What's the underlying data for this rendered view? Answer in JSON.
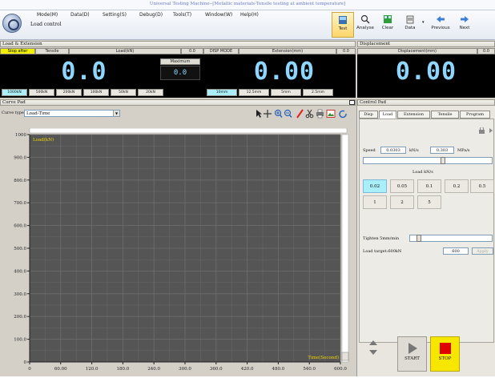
{
  "window": {
    "title": "Universal Testing Machine--[Metallic materials-Tensile testing at ambient temperature]"
  },
  "menu": [
    "Mode(M)",
    "Data(D)",
    "Setting(S)",
    "Debug(D)",
    "Tools(T)",
    "Window(W)",
    "Help(H)"
  ],
  "control_mode": "Load control",
  "toolbar": [
    "Test",
    "Analyse",
    "Clear",
    "Data",
    "Previous",
    "Next"
  ],
  "load_extension": {
    "header": "Load & Extension",
    "stop_label": "Stop after broken",
    "tensile_label": "Tensile",
    "load_label": "Load(kN)",
    "load_value_small": "0.0",
    "load_digits": "0.0",
    "maximum_label": "Maximum",
    "maximum_value": "0.0",
    "disp_mode": "DISP MODE",
    "extension_label": "Extension(mm)",
    "extension_value_small": "0.0",
    "extension_digits": "0.00",
    "load_ranges": [
      "1000kN",
      "500kN",
      "200kN",
      "100kN",
      "50kN",
      "20kN"
    ],
    "active_load_range": 0,
    "ext_ranges": [
      "10mm",
      "12.5mm",
      "5mm",
      "2.5mm"
    ],
    "active_ext_range": 0
  },
  "displacement": {
    "header": "Displacement",
    "label": "Displacement(mm)",
    "value_small": "0.0",
    "digits": "0.00"
  },
  "curve_pad": {
    "header": "Curve Pad",
    "curve_type_label": "Curve type:",
    "curve_type_value": "Load-Time"
  },
  "control_pad": {
    "header": "Control Pad",
    "tabs": [
      "Disp",
      "Load",
      "Extension",
      "Tensile",
      "Program"
    ],
    "active_tab": 1,
    "speed_label": "Speed",
    "speed_kn": "0.0303",
    "speed_kn_unit": "kN/s",
    "speed_mpa": "0.303",
    "speed_mpa_unit": "MPa/s",
    "rate_label": "Load kN/s",
    "rates": [
      "0.02",
      "0.05",
      "0.1",
      "0.2",
      "0.5",
      "1",
      "2",
      "5"
    ],
    "active_rate": 0,
    "tighten_label": "Tighten 5mm/min",
    "load_target_label": "Load target:600kN",
    "load_target_value": "600",
    "apply_label": "Apply",
    "start_label": "START",
    "stop_label": "STOP"
  },
  "chart_data": {
    "type": "line",
    "title": "",
    "xlabel": "Time(Second)",
    "ylabel": "Load(kN)",
    "xlim": [
      0,
      600
    ],
    "ylim": [
      0,
      1000
    ],
    "x_ticks": [
      "0",
      "60.00",
      "120.0",
      "180.0",
      "240.0",
      "300.0",
      "360.0",
      "420.0",
      "480.0",
      "540.0",
      "600.0"
    ],
    "y_ticks": [
      "0",
      "100.0",
      "200.0",
      "300.0",
      "400.0",
      "500.0",
      "600.0",
      "700.0",
      "800.0",
      "900.0",
      "1000"
    ],
    "grid": true,
    "series": []
  },
  "colors": {
    "plot_bg": "#555555",
    "grid": "#6e6e6e",
    "lcd_digits": "#8fd6ff",
    "highlight": "#a9eef9",
    "stop": "#e00000"
  }
}
